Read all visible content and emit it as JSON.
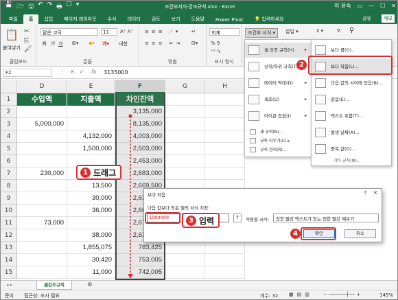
{
  "titlebar": {
    "quick_access": [
      "💾",
      "🗁",
      "🖫",
      "↶",
      "↷",
      "🖶",
      "☐",
      "▾"
    ],
    "title": "조건부서식-강조규칙.xlsx - Excel",
    "user": "이 윤숙",
    "window_controls": [
      "▭",
      "—",
      "☐",
      "✕"
    ]
  },
  "tabs": [
    "파일",
    "홈",
    "삽입",
    "페이지 레이아웃",
    "수식",
    "데이터",
    "검토",
    "보기",
    "도움말",
    "Power Pivot",
    "💡 입력하세요"
  ],
  "tab_active_index": 1,
  "share_label": "공유",
  "memo_label": "메모",
  "ribbon": {
    "clipboard": {
      "label": "클립보드",
      "paste": "붙여넣기"
    },
    "font": {
      "label": "글꼴",
      "name": "맑은 고딕",
      "size": "11"
    },
    "align": {
      "label": "맞춤"
    },
    "number": {
      "label": "표시 형식",
      "format": "회계",
      "pct": "% 9"
    },
    "styles": {
      "cond_format": "조건부 서식 ▾"
    },
    "cells": {
      "insert": "삽입 ▾"
    }
  },
  "namebox": "F2",
  "formula": "3135000",
  "fx": "fx",
  "columns": [
    "D",
    "E",
    "F",
    "G",
    "H"
  ],
  "rows": [
    "1",
    "2",
    "3",
    "4",
    "5",
    "6",
    "7",
    "8",
    "9",
    "10",
    "11",
    "12",
    "13",
    "14",
    "15"
  ],
  "headers": {
    "D": "수입액",
    "E": "지출액",
    "F": "차인잔액"
  },
  "cells": {
    "D": [
      "",
      "5,000,000",
      "",
      "",
      "",
      "230,000",
      "",
      "",
      "",
      "73,000",
      "",
      "",
      "",
      ""
    ],
    "E": [
      "",
      "",
      "4,132,000",
      "1,500,000",
      "",
      "",
      "13,500",
      "30,000",
      "36,000",
      "",
      "38,000",
      "1,855,075",
      "30,420",
      "11,000"
    ],
    "F": [
      "3,135,000",
      "8,135,000",
      "4,003,000",
      "2,503,000",
      "2,453,000",
      "2,683,000",
      "2,669,500",
      "2,639,500",
      "2,603,500",
      "2,676,500",
      "2,638,500",
      "783,425",
      "753,005",
      "742,005"
    ]
  },
  "menu_main": {
    "items": [
      {
        "label": "셀 강조 규칙(H)",
        "icon": "highlight-cells-icon",
        "arrow": "▸",
        "highlighted": true
      },
      {
        "label": "상위/하위 규칙(T)",
        "icon": "top-bottom-icon",
        "arrow": "▸"
      },
      {
        "label": "데이터 막대(D)",
        "icon": "data-bar-icon",
        "arrow": "▸"
      },
      {
        "label": "색조(S)",
        "icon": "color-scale-icon",
        "arrow": "▸"
      },
      {
        "label": "아이콘 집합(I)",
        "icon": "icon-set-icon",
        "arrow": "▸"
      }
    ],
    "small_items": [
      "새 규칙(N)...",
      "규칙 지우기(C) ▸",
      "규칙 관리(R)..."
    ]
  },
  "menu_sub": {
    "items": [
      {
        "label": "보다 큼(G)...",
        "icon": "greater-than-icon"
      },
      {
        "label": "보다 작음(L)...",
        "icon": "less-than-icon",
        "highlighted": true
      },
      {
        "label": "다음 값의 사이에 있음(B)...",
        "icon": "between-icon"
      },
      {
        "label": "같음(E)...",
        "icon": "equal-to-icon"
      },
      {
        "label": "텍스트 포함(T)...",
        "icon": "text-contains-icon"
      },
      {
        "label": "발생 날짜(A)...",
        "icon": "date-occurring-icon"
      },
      {
        "label": "중복 값(D)...",
        "icon": "duplicate-values-icon"
      }
    ],
    "footer": "기타 규칙(M)..."
  },
  "dialog": {
    "title": "보다 작음",
    "help": "?",
    "close": "✕",
    "prompt": "다음 값보다 작은 셀의 서식 지정:",
    "input_value": "1000000",
    "ref_icon": "↑",
    "format_label": "적용할 서식:",
    "format_value": "진한 빨강 텍스트가 있는 연한 빨강 채우기",
    "ok": "확인",
    "cancel": "취소"
  },
  "callouts": {
    "drag": "드래그",
    "input": "입력",
    "n1": "1",
    "n2": "2",
    "n3": "3",
    "n4": "4"
  },
  "sheet_tab": "셀강조규칙",
  "status": {
    "ready": "준비",
    "access": "접근성: 조사 필요",
    "count": "개수: 32",
    "zoom": "145%"
  }
}
